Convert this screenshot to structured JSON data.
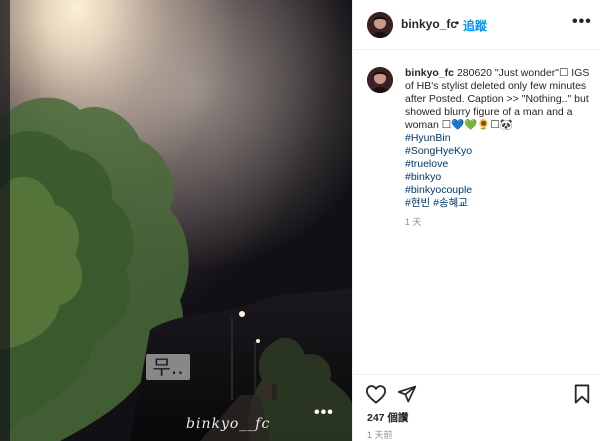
{
  "media": {
    "caption_badge": "무..",
    "watermark": "binkyo__fc",
    "more_label": "•••"
  },
  "header": {
    "username": "binkyo_fc",
    "separator": "•",
    "follow_label": "追蹤",
    "more_label": "•••",
    "more_icon": "ellipsis-icon"
  },
  "comment": {
    "username": "binkyo_fc",
    "text": "280620 \"Just wonder\"☐ IGS of HB's stylist deleted only few minutes after Posted. Caption >> \"Nothing..\" but showed blurry figure of a man and a woman ☐💙💚🌻☐🐼",
    "hashtags": [
      "#HyunBin",
      "#SongHyeKyo",
      "#truelove",
      "#binkyo",
      "#binkyocouple",
      "#현빈 #송혜교"
    ],
    "time": "1 天"
  },
  "actions": {
    "like_icon": "heart-icon",
    "share_icon": "paper-plane-icon",
    "save_icon": "bookmark-icon",
    "likes": "247 個讚",
    "time": "1 天前"
  },
  "colors": {
    "link": "#0095f6",
    "hashtag": "#00376b",
    "muted": "#8e8e8e",
    "text": "#262626"
  }
}
